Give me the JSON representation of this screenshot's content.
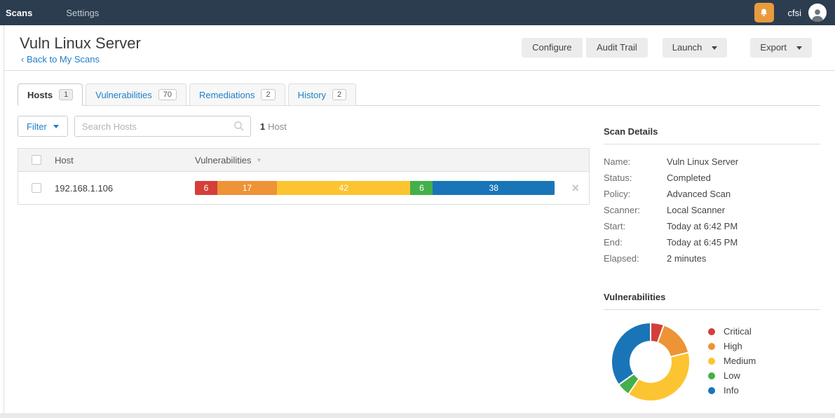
{
  "topbar": {
    "brand": "Scans",
    "menu_settings": "Settings",
    "username": "cfsi",
    "notification_color": "#e89b3c"
  },
  "header": {
    "title": "Vuln Linux Server",
    "back_link": "‹ Back to My Scans",
    "configure_label": "Configure",
    "audit_trail_label": "Audit Trail",
    "launch_label": "Launch",
    "export_label": "Export"
  },
  "tabs": [
    {
      "label": "Hosts",
      "count": "1",
      "active": true
    },
    {
      "label": "Vulnerabilities",
      "count": "70",
      "active": false
    },
    {
      "label": "Remediations",
      "count": "2",
      "active": false
    },
    {
      "label": "History",
      "count": "2",
      "active": false
    }
  ],
  "toolbar": {
    "filter_label": "Filter",
    "search_placeholder": "Search Hosts",
    "host_count": "1",
    "host_count_label": "Host"
  },
  "hosts_table": {
    "col_host": "Host",
    "col_vulnerabilities": "Vulnerabilities",
    "rows": [
      {
        "host": "192.168.1.106",
        "severity_counts": [
          6,
          17,
          42,
          6,
          38
        ]
      }
    ]
  },
  "severity": {
    "labels": [
      "Critical",
      "High",
      "Medium",
      "Low",
      "Info"
    ],
    "colors": [
      "#d43f3a",
      "#ee9336",
      "#fdc431",
      "#43b049",
      "#1975b8"
    ]
  },
  "scan_details": {
    "title": "Scan Details",
    "fields": [
      {
        "label": "Name:",
        "value": "Vuln Linux Server"
      },
      {
        "label": "Status:",
        "value": "Completed"
      },
      {
        "label": "Policy:",
        "value": "Advanced Scan"
      },
      {
        "label": "Scanner:",
        "value": "Local Scanner"
      },
      {
        "label": "Start:",
        "value": "Today at 6:42 PM"
      },
      {
        "label": "End:",
        "value": "Today at 6:45 PM"
      },
      {
        "label": "Elapsed:",
        "value": "2 minutes"
      }
    ]
  },
  "vulnerabilities_panel": {
    "title": "Vulnerabilities"
  },
  "chart_data": {
    "type": "pie",
    "donut": true,
    "title": "Vulnerabilities",
    "labels": [
      "Critical",
      "High",
      "Medium",
      "Low",
      "Info"
    ],
    "values": [
      6,
      17,
      42,
      6,
      38
    ],
    "colors": [
      "#d43f3a",
      "#ee9336",
      "#fdc431",
      "#43b049",
      "#1975b8"
    ],
    "legend_position": "right",
    "start_angle_deg": 0,
    "direction": "clockwise"
  }
}
